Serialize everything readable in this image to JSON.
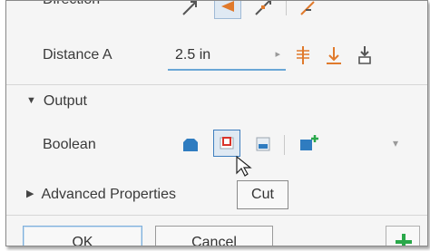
{
  "direction": {
    "label": "Direction",
    "icons": [
      "direction-default-icon",
      "direction-flipped-icon",
      "direction-symmetric-icon",
      "direction-asymmetric-icon"
    ]
  },
  "distance_a": {
    "label": "Distance A",
    "value": "2.5 in",
    "spinner": "▸",
    "icons": [
      "distance-extents-icon",
      "to-next-icon",
      "to-icon"
    ]
  },
  "output": {
    "label": "Output",
    "expand_glyph": "▼",
    "boolean": {
      "label": "Boolean",
      "options": [
        "join-icon",
        "cut-icon",
        "intersect-icon",
        "new-solid-icon"
      ],
      "selected": "cut-icon",
      "more_glyph": "▾"
    }
  },
  "advanced": {
    "label": "Advanced Properties",
    "expand_glyph": "▶"
  },
  "tooltip": {
    "text": "Cut"
  },
  "footer": {
    "ok_label": "OK",
    "cancel_label": "Cancel",
    "apply_icon": "plus-icon"
  },
  "colors": {
    "accent_blue": "#2f7cc0",
    "cut_red": "#d9342b",
    "orange": "#e07a2c",
    "green": "#2aa84a"
  }
}
